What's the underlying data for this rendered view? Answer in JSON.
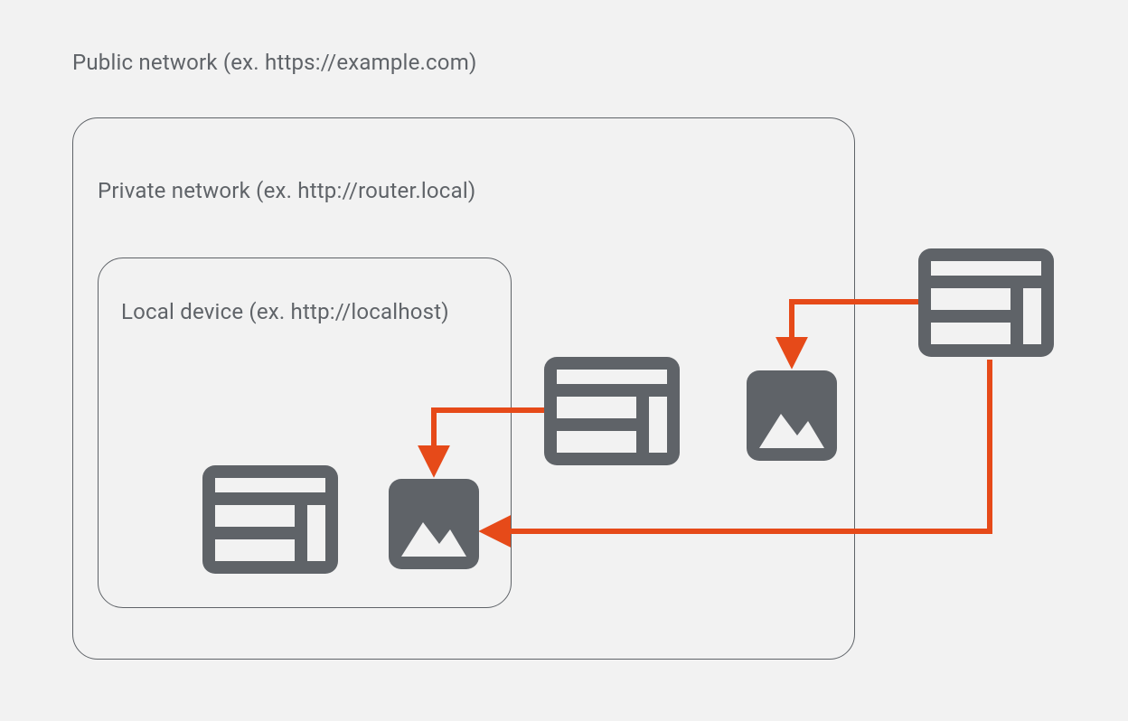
{
  "labels": {
    "public": "Public network (ex. https://example.com)",
    "private": "Private network (ex. http://router.local)",
    "local": "Local device (ex. http://localhost)"
  },
  "colors": {
    "icon": "#5f6368",
    "arrow": "#e64a19",
    "border": "#5f6368",
    "bg": "#f2f2f2"
  },
  "nodes": {
    "public_browser": {
      "type": "browser",
      "zone": "public"
    },
    "private_browser": {
      "type": "browser",
      "zone": "private"
    },
    "private_image": {
      "type": "image",
      "zone": "private"
    },
    "local_browser": {
      "type": "browser",
      "zone": "local"
    },
    "local_image": {
      "type": "image",
      "zone": "local"
    }
  },
  "arrows": [
    {
      "from": "public_browser",
      "to": "private_image"
    },
    {
      "from": "public_browser",
      "to": "local_image"
    },
    {
      "from": "private_browser",
      "to": "local_image"
    }
  ]
}
